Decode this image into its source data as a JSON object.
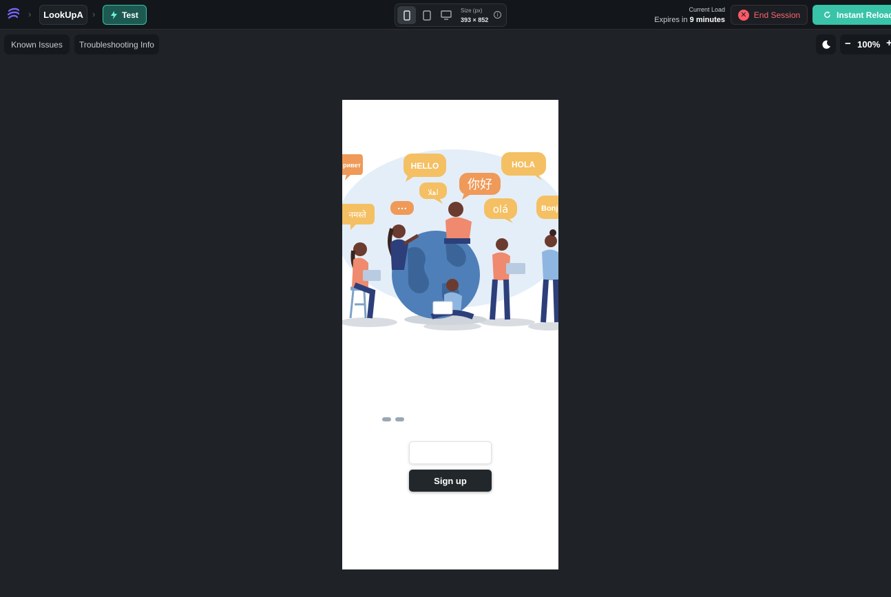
{
  "topbar": {
    "app_name": "LookUpA",
    "mode_label": "Test",
    "size_label": "Size (px)",
    "size_value": "393 × 852",
    "load_label": "Current Load",
    "expires_prefix": "Expires in",
    "expires_value": "9 minutes",
    "end_session_label": "End Session",
    "instant_reload_label": "Instant Reload",
    "icons": [
      "logo-icon",
      "chevron-right-icon",
      "bolt-icon",
      "phone-icon",
      "tablet-icon",
      "desktop-icon",
      "info-icon",
      "close-circle-icon",
      "reload-icon"
    ]
  },
  "toolbar": {
    "known_issues_label": "Known Issues",
    "troubleshooting_label": "Troubleshooting Info",
    "zoom_value": "100%",
    "zoom_minus": "−",
    "zoom_plus": "+",
    "icons": [
      "moon-icon"
    ]
  },
  "phone": {
    "bubbles": {
      "hello": "HELLO",
      "hola": "HOLA",
      "nihao": "你好",
      "ola": "olá",
      "salam": "اهلا",
      "namaste": "नमस्ते",
      "privet": "ривет",
      "bonjour": "Bonj",
      "ellipsis": "•••"
    },
    "signup_label": "Sign up",
    "email_placeholder": ""
  },
  "colors": {
    "accent": "#39c3a9",
    "danger": "#ff5a67",
    "background": "#1f2226",
    "bubble_yellow": "#f4c063",
    "bubble_orange": "#ef9a58",
    "globe_blue": "#4f7fb8"
  }
}
